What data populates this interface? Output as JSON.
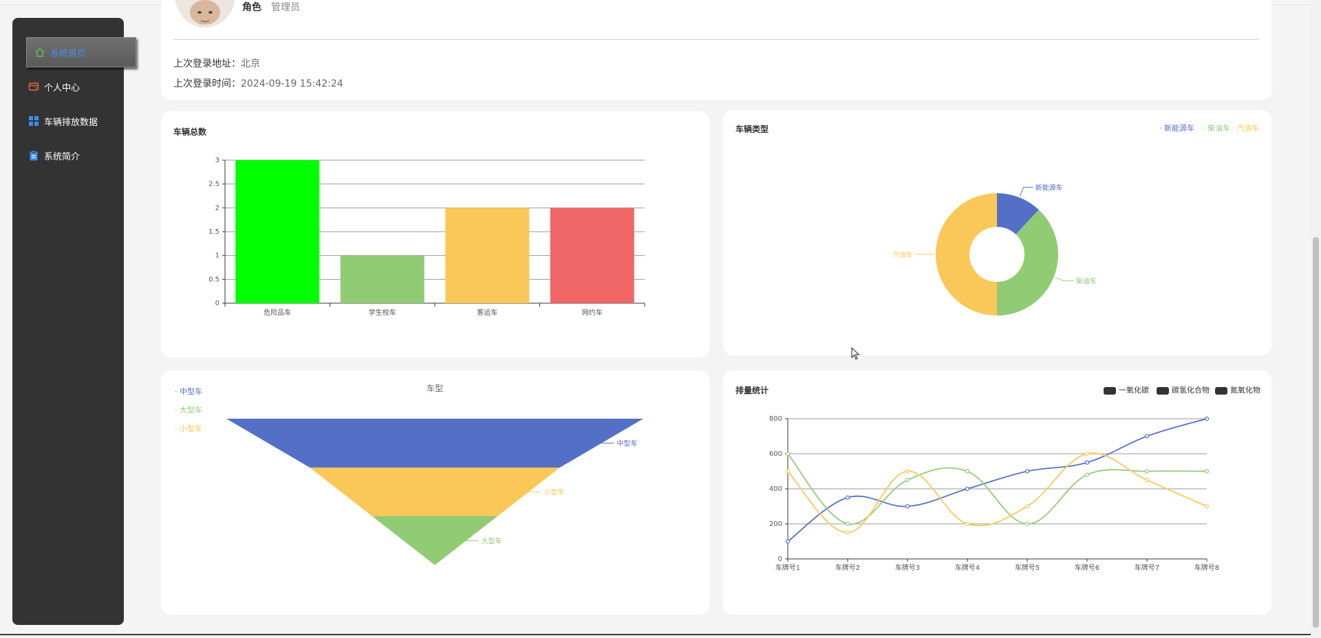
{
  "sidebar": {
    "items": [
      {
        "label": "系统首页",
        "icon": "home-icon",
        "active": true
      },
      {
        "label": "个人中心",
        "icon": "wallet-icon",
        "active": false
      },
      {
        "label": "车辆排放数据",
        "icon": "grid-icon",
        "active": false
      },
      {
        "label": "系统简介",
        "icon": "clipboard-icon",
        "active": false
      }
    ]
  },
  "profile": {
    "username": "角色",
    "role": "管理员",
    "last_login_location_label": "上次登录地址：",
    "last_login_location": "北京",
    "last_login_time_label": "上次登录时间：",
    "last_login_time": "2024-09-19 15:42:24"
  },
  "colors": {
    "blue": "#5470c6",
    "green": "#91cc75",
    "yellow": "#fac858",
    "red": "#ee6666",
    "bright_green": "#00ff00"
  },
  "chart_data": [
    {
      "id": "vehicle-total",
      "type": "bar",
      "title": "车辆总数",
      "categories": [
        "危险品车",
        "学生校车",
        "客运车",
        "网约车"
      ],
      "values": [
        3,
        1,
        2,
        2
      ],
      "bar_colors": [
        "#00ff00",
        "#91cc75",
        "#fac858",
        "#ee6666"
      ],
      "ylim": [
        0,
        3
      ],
      "yticks": [
        "0",
        "0.5",
        "1",
        "1.5",
        "2",
        "2.5",
        "3"
      ],
      "grid": true
    },
    {
      "id": "vehicle-type",
      "type": "pie",
      "title": "车辆类型",
      "donut": true,
      "legend": [
        "新能源车",
        "柴油车",
        "汽油车"
      ],
      "legend_position": "top-right",
      "labels": [
        "新能源车",
        "柴油车",
        "汽油车"
      ],
      "values": [
        12,
        38,
        50
      ],
      "colors": [
        "#5470c6",
        "#91cc75",
        "#fac858"
      ]
    },
    {
      "id": "vehicle-model",
      "type": "funnel",
      "title": "车型",
      "legend": [
        "中型车",
        "大型车",
        "小型车"
      ],
      "legend_position": "top-left",
      "labels": [
        "中型车",
        "小型车",
        "大型车"
      ],
      "values": [
        100,
        60,
        30
      ],
      "colors": [
        "#5470c6",
        "#fac858",
        "#91cc75"
      ]
    },
    {
      "id": "emission-stats",
      "type": "line",
      "title": "排量统计",
      "smooth": true,
      "legend": [
        "一氧化碳",
        "碳氢化合物",
        "氮氧化物"
      ],
      "legend_position": "top-right",
      "x": [
        "车牌号1",
        "车牌号2",
        "车牌号3",
        "车牌号4",
        "车牌号5",
        "车牌号6",
        "车牌号7",
        "车牌号8"
      ],
      "ylim": [
        0,
        800
      ],
      "yticks": [
        "0",
        "200",
        "400",
        "600",
        "800"
      ],
      "grid": true,
      "series": [
        {
          "values": [
            100,
            350,
            300,
            400,
            500,
            550,
            700,
            800
          ],
          "color": "#5470c6"
        },
        {
          "values": [
            600,
            200,
            450,
            500,
            200,
            480,
            500,
            500
          ],
          "color": "#91cc75"
        },
        {
          "values": [
            500,
            150,
            500,
            200,
            300,
            600,
            450,
            300
          ],
          "color": "#fac858"
        }
      ]
    }
  ]
}
